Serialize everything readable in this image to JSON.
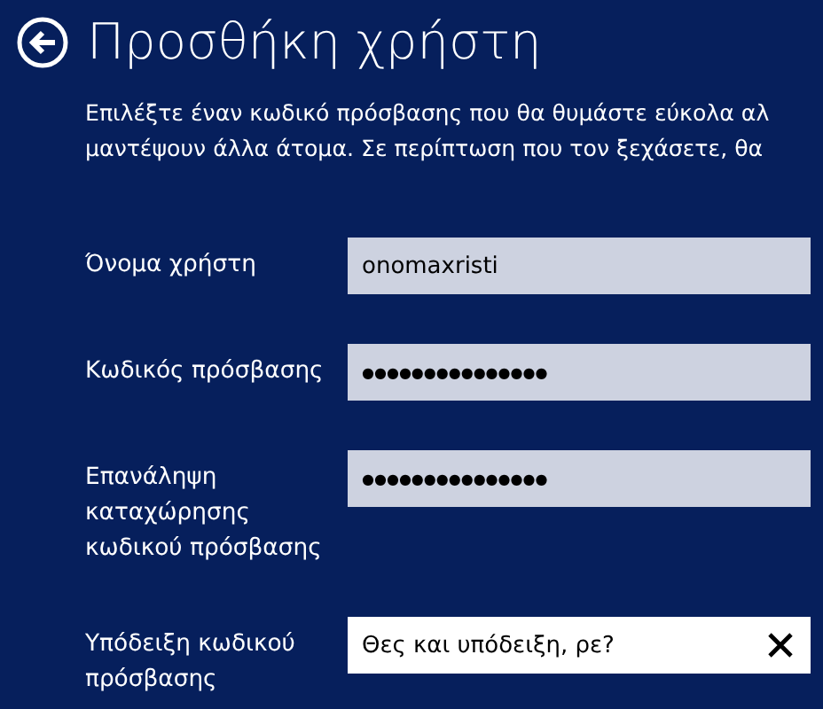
{
  "header": {
    "title": "Προσθήκη χρήστη"
  },
  "description": [
    "Επιλέξτε έναν κωδικό πρόσβασης που θα θυμάστε εύκολα αλ",
    "μαντέψουν άλλα άτομα. Σε περίπτωση που τον ξεχάσετε, θα"
  ],
  "fields": [
    {
      "label": "Όνομα χρήστη",
      "value": "onomaxristi",
      "focused": false
    },
    {
      "label": "Κωδικός πρόσβασης",
      "value": "●●●●●●●●●●●●●●●",
      "focused": false
    },
    {
      "label": "Επανάληψη καταχώρησης κωδικού πρόσβασης",
      "value": "●●●●●●●●●●●●●●●",
      "focused": false
    },
    {
      "label": "Υπόδειξη κωδικού πρόσβασης",
      "value": "Θες και υπόδειξη, ρε?",
      "focused": true
    }
  ]
}
